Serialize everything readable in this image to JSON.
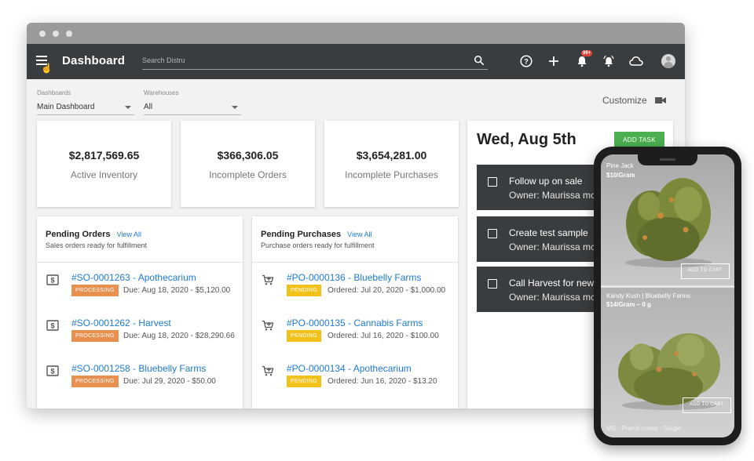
{
  "header": {
    "title": "Dashboard",
    "search_placeholder": "Search Distru",
    "notification_badge": "99+",
    "icons": [
      "menu-icon",
      "search-icon",
      "help-icon",
      "add-icon",
      "notification-bell-icon",
      "alarm-bell-icon",
      "cloud-icon",
      "avatar-icon"
    ]
  },
  "filters": {
    "dashboards_label": "Dashboards",
    "dashboards_value": "Main Dashboard",
    "warehouses_label": "Warehouses",
    "warehouses_value": "All",
    "customize_label": "Customize"
  },
  "stats": [
    {
      "value": "$2,817,569.65",
      "label": "Active Inventory"
    },
    {
      "value": "$366,306.05",
      "label": "Incomplete Orders"
    },
    {
      "value": "$3,654,281.00",
      "label": "Incomplete Purchases"
    }
  ],
  "pending_orders": {
    "title": "Pending Orders",
    "link": "View All",
    "subtitle": "Sales orders ready for fulfillment",
    "rows": [
      {
        "title": "#SO-0001263 - Apothecarium",
        "status": "PROCESSING",
        "meta": "Due: Aug 18, 2020 - $5,120.00"
      },
      {
        "title": "#SO-0001262 - Harvest",
        "status": "PROCESSING",
        "meta": "Due: Aug 18, 2020 - $28,290.66"
      },
      {
        "title": "#SO-0001258 - Bluebelly Farms",
        "status": "PROCESSING",
        "meta": "Due: Jul 29, 2020 - $50.00"
      }
    ]
  },
  "pending_purchases": {
    "title": "Pending Purchases",
    "link": "View All",
    "subtitle": "Purchase orders ready for fulfillment",
    "rows": [
      {
        "title": "#PO-0000136 - Bluebelly Farms",
        "status": "PENDING",
        "meta": "Ordered: Jul 20, 2020 - $1,000.00"
      },
      {
        "title": "#PO-0000135 - Cannabis Farms",
        "status": "PENDING",
        "meta": "Ordered: Jul 16, 2020 - $100.00"
      },
      {
        "title": "#PO-0000134 - Apothecarium",
        "status": "PENDING",
        "meta": "Ordered: Jun 16, 2020 - $13.20"
      }
    ]
  },
  "tasks": {
    "date": "Wed, Aug 5th",
    "add_button": "ADD TASK",
    "items": [
      {
        "title": "Follow up on sale",
        "owner": "Owner: Maurissa mcc"
      },
      {
        "title": "Create test sample",
        "owner": "Owner: Maurissa mcc"
      },
      {
        "title": "Call Harvest for new o",
        "owner": "Owner: Maurissa mcc"
      }
    ]
  },
  "phone": {
    "products": [
      {
        "name": "Pine Jack",
        "price": "$10/Gram",
        "button": "ADD TO CART"
      },
      {
        "name": "Kandy Kush | Bluebelly Farms",
        "price": "$14/Gram – 0 g",
        "button": "ADD TO CART"
      }
    ],
    "footer": "MB - Preroll cones - Single"
  },
  "colors": {
    "appbar": "#3a3d3f",
    "link": "#1e7bd6",
    "processing": "#e8904f",
    "pending": "#f3c21a",
    "add_task": "#4caf50"
  }
}
